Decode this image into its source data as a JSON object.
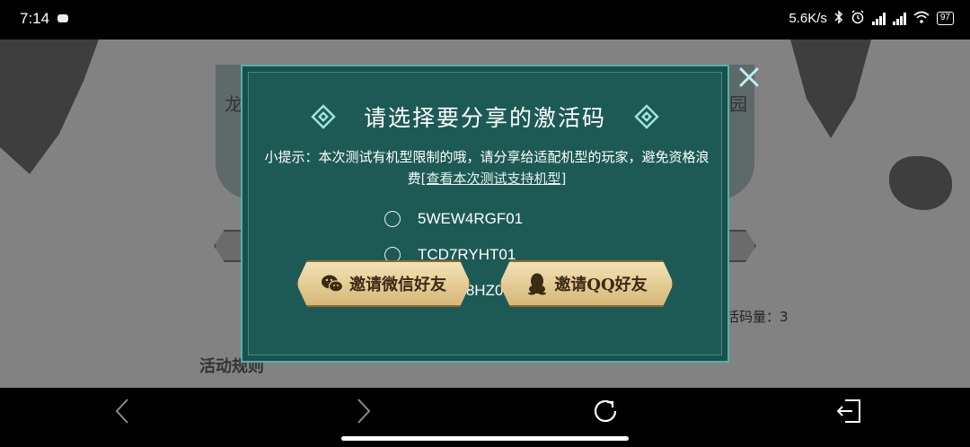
{
  "status_bar": {
    "time": "7:14",
    "net_speed": "5.6K/s",
    "battery": "97",
    "icons": [
      "bluetooth-icon",
      "alarm-icon",
      "signal-icon",
      "signal-icon",
      "wifi-icon",
      "battery-icon"
    ]
  },
  "background": {
    "left_text": "龙",
    "right_text": "园",
    "remaining_codes": "活码量：3",
    "rules": "活动规则"
  },
  "modal": {
    "title": "请选择要分享的激活码",
    "tip_text": "小提示：本次测试有机型限制的哦，请分享给适配机型的玩家，避免资格浪费",
    "tip_link": "[查看本次测试支持机型]",
    "codes": [
      {
        "label": "5WEW4RGF01",
        "selected": false
      },
      {
        "label": "TCD7RYHT01",
        "selected": false
      },
      {
        "label": "TD76H8HZ01",
        "selected": false
      }
    ],
    "invite_wechat": "邀请微信好友",
    "invite_qq": "邀请QQ好友"
  },
  "colors": {
    "modal_bg": "#1d5a56",
    "modal_border": "#4fb3a8",
    "button_gold": "#e6cd93",
    "close_icon": "#bfeff0"
  }
}
